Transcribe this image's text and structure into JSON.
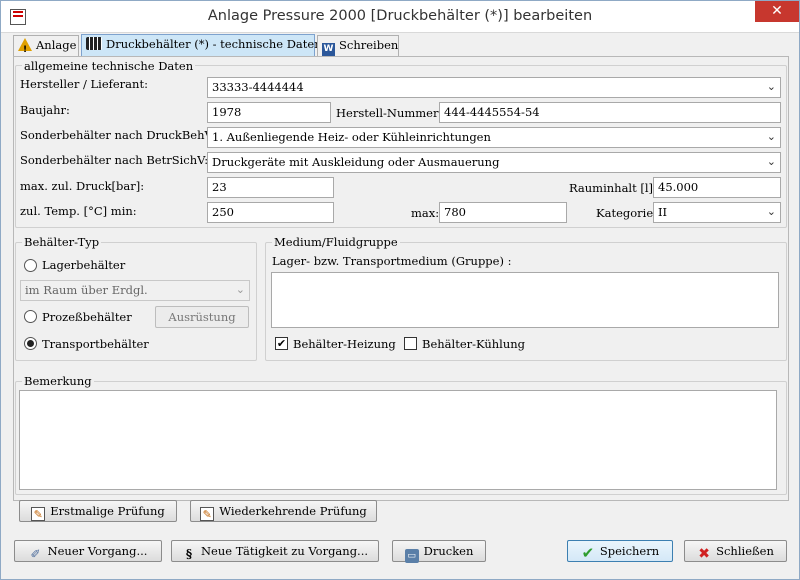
{
  "window": {
    "title": "Anlage Pressure 2000 [Druckbehälter (*)] bearbeiten",
    "close_symbol": "✕"
  },
  "tabs": [
    {
      "label": "Anlage",
      "icon": "warning-icon"
    },
    {
      "label": "Druckbehälter (*) - technische Daten",
      "icon": "cylinders-icon"
    },
    {
      "label": "Schreiben",
      "icon": "word-document-icon"
    }
  ],
  "general": {
    "group_title": "allgemeine technische Daten",
    "hersteller_label": "Hersteller / Lieferant:",
    "hersteller_value": "33333-4444444",
    "baujahr_label": "Baujahr:",
    "baujahr_value": "1978",
    "herstellnr_label": "Herstell-Nummer",
    "herstellnr_value": "444-4445554-54",
    "druckbehv_label": "Sonderbehälter nach DruckBehV:",
    "druckbehv_value": "1. Außenliegende Heiz- oder Kühleinrichtungen",
    "betrsichv_label": "Sonderbehälter nach BetrSichV:",
    "betrsichv_value": "Druckgeräte mit Auskleidung oder Ausmauerung",
    "druck_label": "max. zul. Druck[bar]:",
    "druck_value": "23",
    "rauminhalt_label": "Rauminhalt [l]",
    "rauminhalt_value": "45.000",
    "temp_label": "zul. Temp. [°C] min:",
    "temp_min_value": "250",
    "max_label": "max:",
    "temp_max_value": "780",
    "kategorie_label": "Kategorie",
    "kategorie_value": "II"
  },
  "behaelter_typ": {
    "group_title": "Behälter-Typ",
    "lager_label": "Lagerbehälter",
    "lager_select_value": "im  Raum über Erdgl.",
    "prozess_label": "Prozeßbehälter",
    "ausruestung_label": "Ausrüstung",
    "transport_label": "Transportbehälter",
    "selected": "transport"
  },
  "medium": {
    "group_title": "Medium/Fluidgruppe",
    "medium_label": "Lager- bzw. Transportmedium (Gruppe) :",
    "medium_value": "",
    "heizung_label": "Behälter-Heizung",
    "heizung_checked": true,
    "kuehlung_label": "Behälter-Kühlung",
    "kuehlung_checked": false
  },
  "bemerkung": {
    "group_title": "Bemerkung",
    "value": ""
  },
  "pruefung_buttons": {
    "erstmalig": "Erstmalige Prüfung",
    "wiederkehrend": "Wiederkehrende Prüfung"
  },
  "footer": {
    "neuer_vorgang": "Neuer Vorgang...",
    "neue_taetigkeit": "Neue Tätigkeit zu Vorgang...",
    "drucken": "Drucken",
    "speichern": "Speichern",
    "schliessen": "Schließen"
  },
  "icons": {
    "check_mark": "✔",
    "dropdown_arrow": "⌄"
  }
}
